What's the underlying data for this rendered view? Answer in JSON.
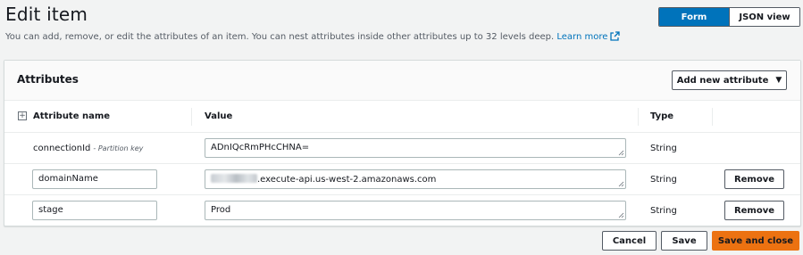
{
  "header": {
    "title": "Edit item",
    "description": "You can add, remove, or edit the attributes of an item. You can nest attributes inside other attributes up to 32 levels deep.",
    "learn_more": "Learn more"
  },
  "view_toggle": {
    "options": [
      "Form",
      "JSON view"
    ],
    "selected": "Form"
  },
  "panel": {
    "title": "Attributes",
    "add_button": "Add new attribute",
    "columns": [
      "Attribute name",
      "Value",
      "Type"
    ],
    "rows": [
      {
        "name": "connectionId",
        "name_tag": "- Partition key",
        "value": "ADnIQcRmPHcCHNA=",
        "type": "String",
        "editable_name": false,
        "removable": false
      },
      {
        "name": "domainName",
        "value": ".execute-api.us-west-2.amazonaws.com",
        "value_redacted_prefix": true,
        "type": "String",
        "editable_name": true,
        "removable": true
      },
      {
        "name": "stage",
        "value": "Prod",
        "type": "String",
        "editable_name": true,
        "removable": true
      }
    ],
    "remove_label": "Remove"
  },
  "footer": {
    "cancel": "Cancel",
    "save": "Save",
    "save_close": "Save and close"
  },
  "colors": {
    "primary": "#0073bb",
    "accent": "#ec7211",
    "background": "#f2f3f3"
  }
}
